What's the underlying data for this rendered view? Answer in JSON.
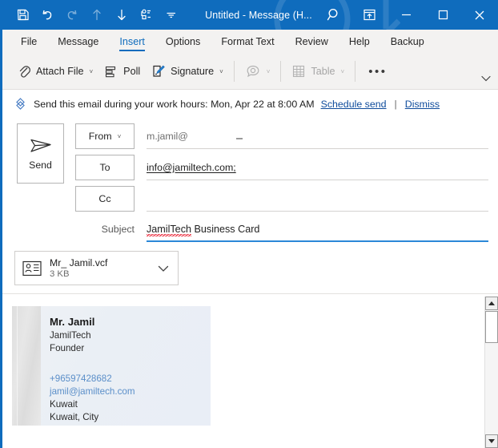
{
  "window": {
    "title": "Untitled  -  Message (H...",
    "quick_access": [
      {
        "name": "save-icon",
        "label": "Save",
        "disabled": false
      },
      {
        "name": "undo-icon",
        "label": "Undo",
        "disabled": false
      },
      {
        "name": "redo-icon",
        "label": "Redo",
        "disabled": true
      },
      {
        "name": "previous-item-icon",
        "label": "Previous Item",
        "disabled": true
      },
      {
        "name": "next-item-icon",
        "label": "Next Item",
        "disabled": false
      },
      {
        "name": "touch-mode-icon",
        "label": "Touch/Mouse Mode",
        "disabled": false
      },
      {
        "name": "customize-qat-icon",
        "label": "Customize Quick Access Toolbar",
        "disabled": false
      }
    ],
    "controls": [
      {
        "name": "search-icon",
        "label": "Search"
      },
      {
        "name": "ribbon-display-options-icon",
        "label": "Ribbon Display Options"
      },
      {
        "name": "minimize-icon",
        "label": "Minimize"
      },
      {
        "name": "maximize-icon",
        "label": "Maximize"
      },
      {
        "name": "close-icon",
        "label": "Close"
      }
    ],
    "accent_color": "#0f6cbd"
  },
  "tabs": [
    {
      "label": "File",
      "active": false
    },
    {
      "label": "Message",
      "active": false
    },
    {
      "label": "Insert",
      "active": true
    },
    {
      "label": "Options",
      "active": false
    },
    {
      "label": "Format Text",
      "active": false
    },
    {
      "label": "Review",
      "active": false
    },
    {
      "label": "Help",
      "active": false
    },
    {
      "label": "Backup",
      "active": false
    }
  ],
  "ribbon": {
    "attach_file": {
      "label": "Attach File",
      "icon": "paperclip-icon",
      "chevron": "˅"
    },
    "poll": {
      "label": "Poll",
      "icon": "poll-icon"
    },
    "signature": {
      "label": "Signature",
      "icon": "signature-icon",
      "chevron": "˅"
    },
    "link_tool": {
      "label": "",
      "icon": "link-bubble-icon",
      "chevron": "˅"
    },
    "table": {
      "label": "Table",
      "icon": "table-icon",
      "chevron": "˅"
    },
    "more": {
      "label": "•••"
    },
    "collapse": {
      "label": "collapse-ribbon-icon"
    }
  },
  "infobar": {
    "icon": "insights-icon",
    "message": "Send this email during your work hours: Mon, Apr 22 at 8:00 AM",
    "schedule_link": "Schedule send",
    "divider": "|",
    "dismiss_link": "Dismiss"
  },
  "compose": {
    "send_label": "Send",
    "send_icon": "send-paper-plane-icon",
    "from": {
      "button_label": "From",
      "chevron": "˅",
      "value": "m.jamil@"
    },
    "to": {
      "button_label": "To",
      "value": "info@jamiltech.com;"
    },
    "cc": {
      "button_label": "Cc",
      "value": ""
    },
    "subject": {
      "label": "Subject",
      "value_misspelled": "JamilTech",
      "value_rest": " Business Card"
    }
  },
  "attachment": {
    "icon": "vcard-contact-icon",
    "name": "Mr_ Jamil.vcf",
    "size": "3 KB",
    "chevron": "˅"
  },
  "business_card": {
    "name": "Mr. Jamil",
    "company": "JamilTech",
    "title": "Founder",
    "phone": "+96597428682",
    "email": "jamil@jamiltech.com",
    "country": "Kuwait",
    "city": "Kuwait, City",
    "link_color": "#5b8fc9"
  },
  "scrollbar": {
    "up_label": "Scroll up",
    "down_label": "Scroll down",
    "thumb_label": "Scroll thumb"
  }
}
